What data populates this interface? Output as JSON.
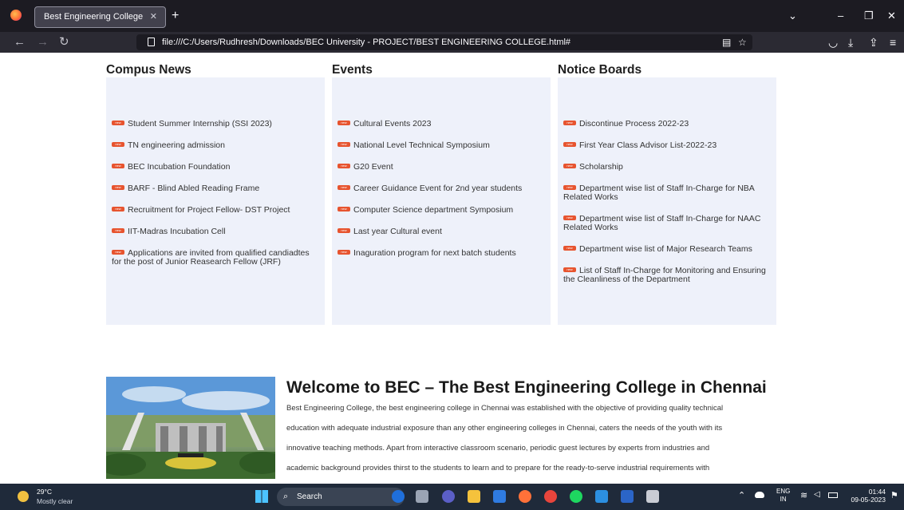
{
  "browser": {
    "tab_title": "Best Engineering College",
    "url": "file:///C:/Users/Rudhresh/Downloads/BEC University - PROJECT/BEST ENGINEERING COLLEGE.html#"
  },
  "new_badge": "new",
  "news": {
    "title": "Compus News",
    "items": [
      "Student Summer Internship (SSI 2023)",
      "TN engineering admission",
      "BEC Incubation Foundation",
      "BARF - Blind Abled Reading Frame",
      "Recruitment for Project Fellow- DST Project",
      "IIT-Madras Incubation Cell",
      "Applications are invited from qualified candiadtes for the post of Junior Reasearch Fellow (JRF)"
    ]
  },
  "events": {
    "title": "Events",
    "items": [
      "Cultural Events 2023",
      "National Level Technical Symposium",
      "G20 Event",
      "Career Guidance Event for 2nd year students",
      "Computer Science department Symposium",
      "Last year Cultural event",
      "Inaguration program for next batch students"
    ]
  },
  "notices": {
    "title": "Notice Boards",
    "items": [
      "Discontinue Process 2022-23",
      "First Year Class Advisor List-2022-23",
      "Scholarship",
      "Department wise list of Staff In-Charge for NBA Related Works",
      "Department wise list of Staff In-Charge for NAAC Related Works",
      "Department wise list of Major Research Teams",
      "List of Staff In-Charge for Monitoring and Ensuring the Cleanliness of the Department"
    ]
  },
  "welcome": {
    "title": "Welcome to BEC – The Best Engineering College in Chennai",
    "lines": [
      "Best Engineering College, the best engineering college in Chennai was established with the objective of providing quality technical",
      "education with adequate industrial exposure than any other engineering colleges in Chennai, caters the needs of the youth with its",
      "innovative teaching methods. Apart from interactive classroom scenario, periodic guest lectures by experts from industries and",
      "academic background provides thirst to the students to learn and to prepare for the ready-to-serve industrial requirements with"
    ]
  },
  "taskbar": {
    "temp": "29°C",
    "weather": "Mostly clear",
    "search": "Search",
    "lang1": "ENG",
    "lang2": "IN",
    "time": "01:44",
    "date": "09-05-2023"
  }
}
